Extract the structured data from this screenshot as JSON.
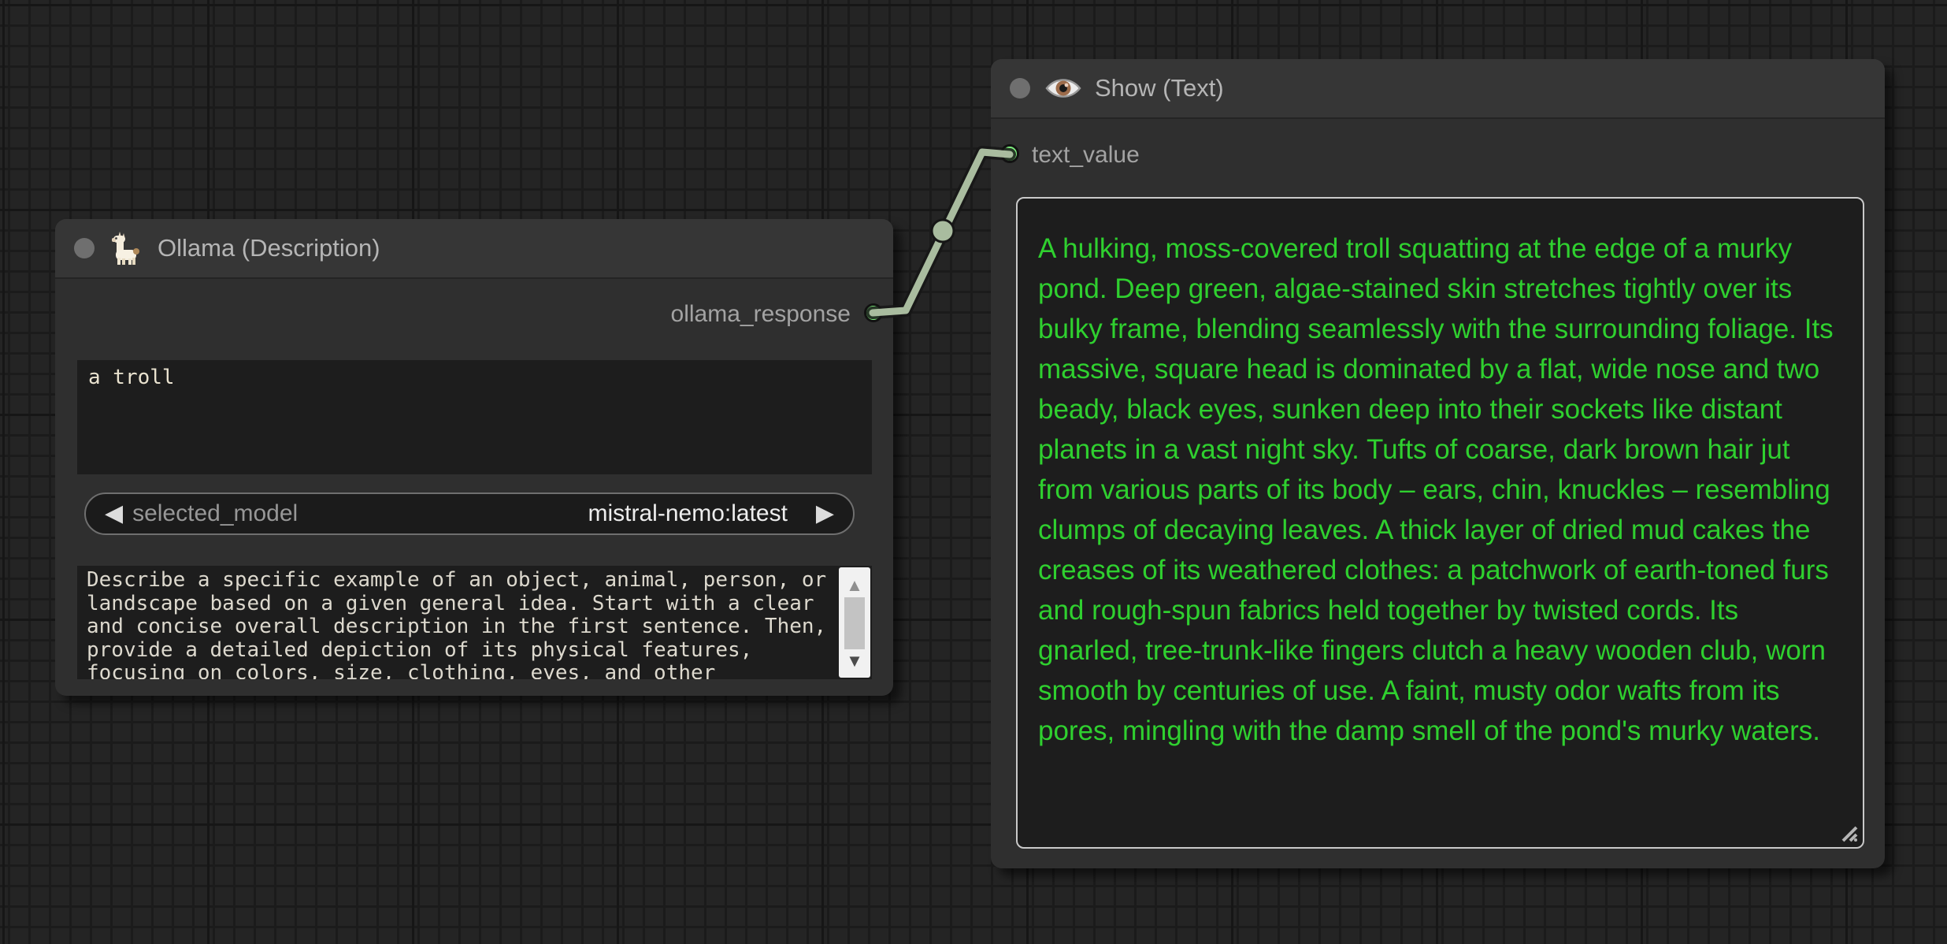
{
  "ollama_node": {
    "title": "Ollama (Description)",
    "output_label": "ollama_response",
    "prompt_input_value": "a troll",
    "combo": {
      "label": "selected_model",
      "value": "mistral-nemo:latest"
    },
    "system_prompt": "Describe a specific example of an object, animal, person, or landscape based on a given general idea. Start with a clear and concise overall description in the first sentence. Then, provide a detailed depiction of its physical features, focusing on colors, size, clothing, eyes, and other"
  },
  "show_node": {
    "title": "Show (Text)",
    "input_label": "text_value",
    "text_value": "A hulking, moss-covered troll squatting at the edge of a murky pond. Deep green, algae-stained skin stretches tightly over its bulky frame, blending seamlessly with the surrounding foliage. Its massive, square head is dominated by a flat, wide nose and two beady, black eyes, sunken deep into their sockets like distant planets in a vast night sky. Tufts of coarse, dark brown hair jut from various parts of its body – ears, chin, knuckles – resembling clumps of decaying leaves. A thick layer of dried mud cakes the creases of its weathered clothes: a patchwork of earth-toned furs and rough-spun fabrics held together by twisted cords. Its gnarled, tree-trunk-like fingers clutch a heavy wooden club, worn smooth by centuries of use. A faint, musty odor wafts from its pores, mingling with the damp smell of the pond's murky waters."
  },
  "link": {
    "from": "ollama_response",
    "to": "text_value"
  },
  "icons": {
    "llama": "llama-icon",
    "eye": "eye-icon",
    "combo_prev": "◀",
    "combo_next": "▶",
    "scroll_up": "▲",
    "scroll_down": "▼"
  },
  "colors": {
    "canvas_bg": "#242424",
    "grid_line": "#1b1b1b",
    "node_body": "#2f2f2f",
    "node_header": "#363636",
    "title_text": "#b5b5b5",
    "slot_green": "#7ef07e",
    "link": "#a9bc9f",
    "widget_bg": "#1d1d1d",
    "combo_border": "#6f6f6f",
    "response_text_green": "#2fd02f",
    "mono_text": "#ddd9ce",
    "scroll_track": "#f1f1f1",
    "scroll_thumb": "#c3c3c3"
  }
}
